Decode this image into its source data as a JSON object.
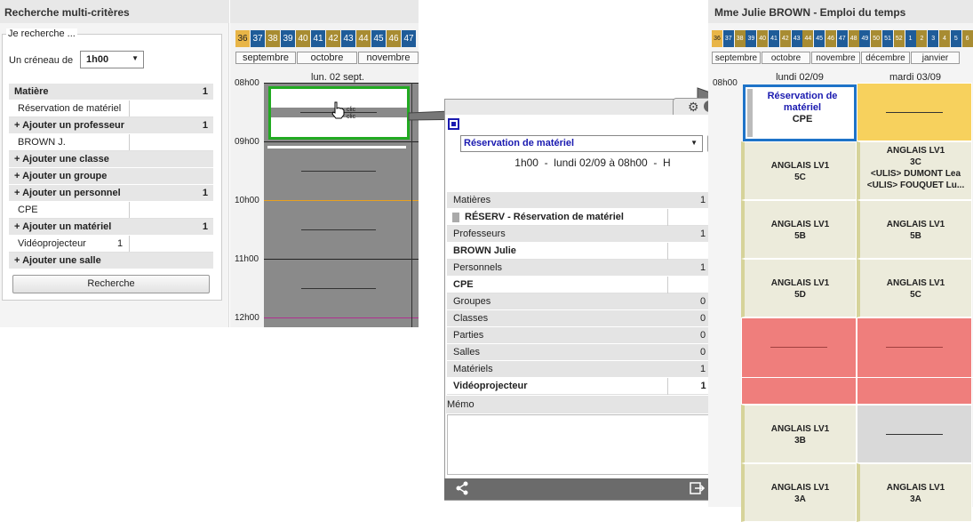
{
  "left": {
    "title": "Recherche multi-critères",
    "search_legend": "Je recherche ...",
    "slot_label": "Un créneau de",
    "slot_value": "1h00",
    "criteria": [
      {
        "kind": "head",
        "label": "Matière",
        "count": "1"
      },
      {
        "kind": "val",
        "label": "Réservation de matériel"
      },
      {
        "kind": "head",
        "label": "+ Ajouter un professeur",
        "count": "1"
      },
      {
        "kind": "val",
        "label": "BROWN J."
      },
      {
        "kind": "head",
        "label": "+ Ajouter une classe",
        "count": ""
      },
      {
        "kind": "head",
        "label": "+ Ajouter un groupe",
        "count": ""
      },
      {
        "kind": "head",
        "label": "+ Ajouter un personnel",
        "count": "1"
      },
      {
        "kind": "val",
        "label": "CPE"
      },
      {
        "kind": "head",
        "label": "+ Ajouter un matériel",
        "count": "1"
      },
      {
        "kind": "val",
        "label": "Vidéoprojecteur",
        "qty": "1"
      },
      {
        "kind": "head",
        "label": "+ Ajouter une salle",
        "count": ""
      }
    ],
    "search_button": "Recherche"
  },
  "mid": {
    "weeks": [
      "36",
      "37",
      "38",
      "39",
      "40",
      "41",
      "42",
      "43",
      "44",
      "45",
      "46",
      "47"
    ],
    "months": [
      "septembre",
      "octobre",
      "novembre"
    ],
    "day": "lun. 02 sept.",
    "hours": [
      "08h00",
      "09h00",
      "10h00",
      "11h00",
      "12h00"
    ],
    "click_label": "clic"
  },
  "popup": {
    "subject_select": "Réservation de matériel",
    "more_button": "...",
    "info": "1h00  -  lundi 02/09 à 08h00  -  H",
    "rows": [
      {
        "kind": "head",
        "label": "Matières",
        "value": "1"
      },
      {
        "kind": "val",
        "label": "RÉSERV - Réservation de matériel",
        "value": ""
      },
      {
        "kind": "head",
        "label": "Professeurs",
        "value": "1"
      },
      {
        "kind": "val",
        "label": "BROWN Julie",
        "value": ""
      },
      {
        "kind": "head",
        "label": "Personnels",
        "value": "1"
      },
      {
        "kind": "val",
        "label": "CPE",
        "value": ""
      },
      {
        "kind": "head",
        "label": "Groupes",
        "value": "0"
      },
      {
        "kind": "head",
        "label": "Classes",
        "value": "0"
      },
      {
        "kind": "head",
        "label": "Parties",
        "value": "0"
      },
      {
        "kind": "head",
        "label": "Salles",
        "value": "0"
      },
      {
        "kind": "head",
        "label": "Matériels",
        "value": "1"
      },
      {
        "kind": "val",
        "label": "Vidéoprojecteur",
        "value": "1"
      }
    ],
    "memo_label": "Mémo"
  },
  "right": {
    "title": "Mme Julie BROWN - Emploi du temps",
    "weeks": [
      "36",
      "37",
      "38",
      "39",
      "40",
      "41",
      "42",
      "43",
      "44",
      "45",
      "46",
      "47",
      "48",
      "49",
      "50",
      "51",
      "52",
      "1",
      "2",
      "3",
      "4",
      "5",
      "6"
    ],
    "months": [
      "septembre",
      "octobre",
      "novembre",
      "décembre",
      "janvier"
    ],
    "days": [
      "lundi 02/09",
      "mardi 03/09"
    ],
    "hour": "08h00",
    "reservation": {
      "line1": "Réservation de",
      "line2": "matériel",
      "line3": "CPE"
    },
    "col1": [
      {
        "l1": "ANGLAIS LV1",
        "l2": "5C"
      },
      {
        "l1": "ANGLAIS LV1",
        "l2": "5B"
      },
      {
        "l1": "ANGLAIS LV1",
        "l2": "5D"
      },
      {
        "l1": "ANGLAIS LV1",
        "l2": "3B"
      },
      {
        "l1": "ANGLAIS LV1",
        "l2": "3A"
      }
    ],
    "col2": [
      {
        "l1": "ANGLAIS LV1",
        "l2": "3C",
        "l3": "<ULIS> DUMONT Lea",
        "l4": "<ULIS> FOUQUET Lu..."
      },
      {
        "l1": "ANGLAIS LV1",
        "l2": "5B"
      },
      {
        "l1": "ANGLAIS LV1",
        "l2": "5C"
      },
      {
        "l1": "ANGLAIS LV1",
        "l2": "3A"
      }
    ]
  },
  "colors": {
    "week_blue": "#1f5c99",
    "week_gold": "#a88c32",
    "week_current": "#e8b547",
    "selection_green": "#22aa22",
    "selection_blue": "#1e73c8",
    "popup_footer": "#6b6b6b",
    "reservation_blue": "#1a1ab0"
  }
}
